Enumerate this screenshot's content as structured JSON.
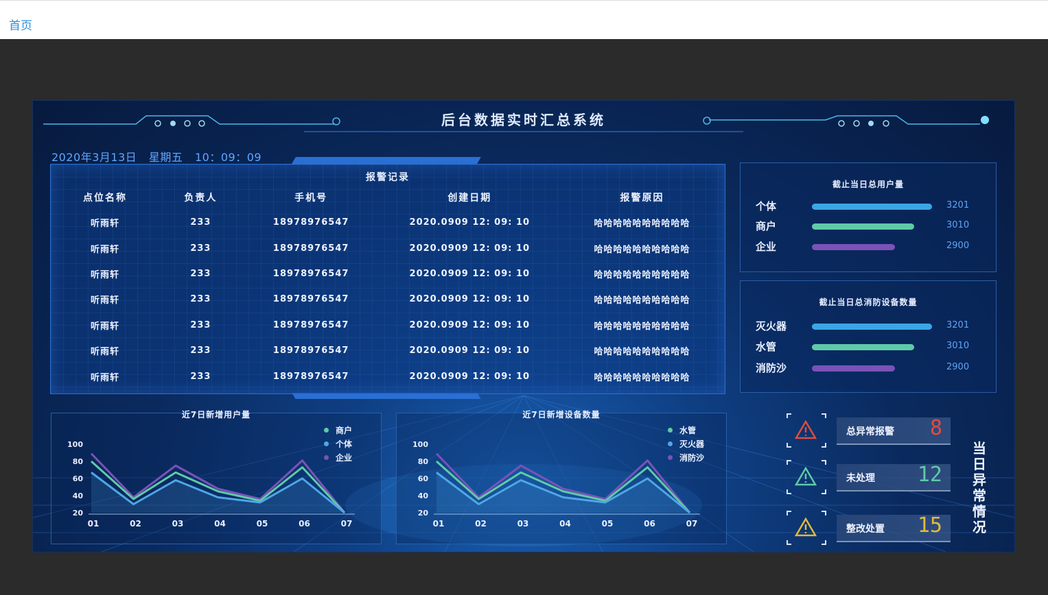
{
  "nav": {
    "home": "首页"
  },
  "header": {
    "title": "后台数据实时汇总系统"
  },
  "datetime": {
    "date": "2020年3月13日",
    "weekday": "星期五",
    "time": "10：09：09"
  },
  "alarm_table": {
    "title": "报警记录",
    "columns": [
      "点位名称",
      "负责人",
      "手机号",
      "创建日期",
      "报警原因"
    ],
    "rows": [
      [
        "听雨轩",
        "233",
        "18978976547",
        "2020.0909 12: 09: 10",
        "哈哈哈哈哈哈哈哈哈哈"
      ],
      [
        "听雨轩",
        "233",
        "18978976547",
        "2020.0909 12: 09: 10",
        "哈哈哈哈哈哈哈哈哈哈"
      ],
      [
        "听雨轩",
        "233",
        "18978976547",
        "2020.0909 12: 09: 10",
        "哈哈哈哈哈哈哈哈哈哈"
      ],
      [
        "听雨轩",
        "233",
        "18978976547",
        "2020.0909 12: 09: 10",
        "哈哈哈哈哈哈哈哈哈哈"
      ],
      [
        "听雨轩",
        "233",
        "18978976547",
        "2020.0909 12: 09: 10",
        "哈哈哈哈哈哈哈哈哈哈"
      ],
      [
        "听雨轩",
        "233",
        "18978976547",
        "2020.0909 12: 09: 10",
        "哈哈哈哈哈哈哈哈哈哈"
      ],
      [
        "听雨轩",
        "233",
        "18978976547",
        "2020.0909 12: 09: 10",
        "哈哈哈哈哈哈哈哈哈哈"
      ]
    ]
  },
  "users_stat": {
    "title": "截止当日总用户量",
    "items": [
      {
        "label": "个体",
        "value": "3201",
        "fraction": 0.97,
        "color": "#3aa6e6"
      },
      {
        "label": "商户",
        "value": "3010",
        "fraction": 0.83,
        "color": "#5fcaa8"
      },
      {
        "label": "企业",
        "value": "2900",
        "fraction": 0.67,
        "color": "#7a52b8"
      }
    ]
  },
  "devices_stat": {
    "title": "截止当日总消防设备数量",
    "items": [
      {
        "label": "灭火器",
        "value": "3201",
        "fraction": 0.97,
        "color": "#3aa6e6"
      },
      {
        "label": "水管",
        "value": "3010",
        "fraction": 0.83,
        "color": "#5fcaa8"
      },
      {
        "label": "消防沙",
        "value": "2900",
        "fraction": 0.67,
        "color": "#7a52b8"
      }
    ]
  },
  "anomaly": {
    "title": "当日异常情况",
    "items": [
      {
        "label": "总异常报警",
        "value": "8",
        "icon": "warning-icon",
        "icon_color": "#e24b3b",
        "value_color": "#e24b3b"
      },
      {
        "label": "未处理",
        "value": "12",
        "icon": "warning-icon",
        "icon_color": "#5fcaa8",
        "value_color": "#5fcaa8"
      },
      {
        "label": "整改处置",
        "value": "15",
        "icon": "warning-icon",
        "icon_color": "#e2b93b",
        "value_color": "#e2b93b"
      }
    ]
  },
  "chart_data": [
    {
      "type": "line",
      "title": "近7日新增用户量",
      "categories": [
        "01",
        "02",
        "03",
        "04",
        "05",
        "06",
        "07"
      ],
      "yticks": [
        100,
        80,
        60,
        40,
        20
      ],
      "ylim": [
        20,
        100
      ],
      "legend": "top-right",
      "series": [
        {
          "name": "商户",
          "color": "#5fcaa8",
          "values": [
            80,
            36,
            67,
            45,
            34,
            73,
            20
          ]
        },
        {
          "name": "个体",
          "color": "#4fa7e6",
          "values": [
            67,
            30,
            58,
            38,
            32,
            60,
            20
          ]
        },
        {
          "name": "企业",
          "color": "#7a52b8",
          "values": [
            89,
            38,
            75,
            48,
            36,
            81,
            20
          ]
        }
      ]
    },
    {
      "type": "line",
      "title": "近7日新增设备数量",
      "categories": [
        "01",
        "02",
        "03",
        "04",
        "05",
        "06",
        "07"
      ],
      "yticks": [
        100,
        80,
        60,
        40,
        20
      ],
      "ylim": [
        20,
        100
      ],
      "legend": "top-right",
      "series": [
        {
          "name": "水管",
          "color": "#5fcaa8",
          "values": [
            80,
            36,
            67,
            45,
            34,
            73,
            20
          ]
        },
        {
          "name": "灭火器",
          "color": "#4fa7e6",
          "values": [
            67,
            30,
            58,
            38,
            32,
            60,
            20
          ]
        },
        {
          "name": "消防沙",
          "color": "#7a52b8",
          "values": [
            89,
            38,
            75,
            48,
            36,
            81,
            20
          ]
        }
      ]
    }
  ]
}
